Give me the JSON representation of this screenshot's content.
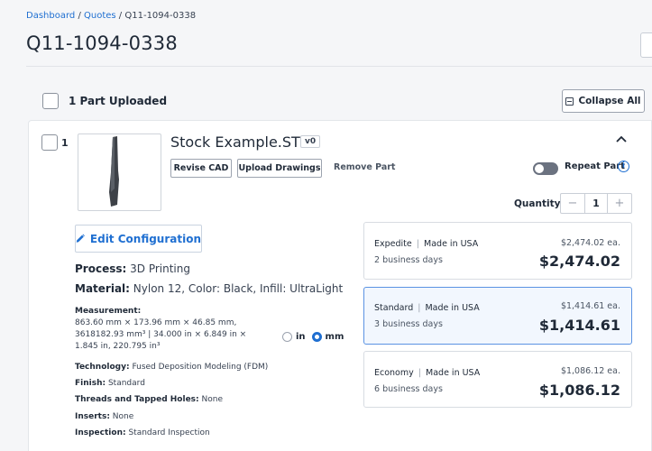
{
  "breadcrumb": {
    "dashboard": "Dashboard",
    "quotes": "Quotes",
    "current": "Q11-1094-0338",
    "sep": " / "
  },
  "page": {
    "title": "Q11-1094-0338"
  },
  "header": {
    "uploaded_label": "1 Part Uploaded",
    "collapse_label": "Collapse All"
  },
  "part": {
    "number": "1",
    "name": "Stock Example.STL",
    "version": "v0",
    "revise_cad": "Revise CAD",
    "upload_drawings": "Upload Drawings",
    "remove": "Remove Part",
    "repeat_label": "Repeat Part",
    "repeat_on": false,
    "quantity_label": "Quantity",
    "quantity": "1",
    "edit_config": "Edit Configuration",
    "process_label": "Process:",
    "process": "3D Printing",
    "material_label": "Material:",
    "material": "Nylon 12, Color: Black, Infill: UltraLight",
    "measurement_label": "Measurement:",
    "measurement_lines": [
      "863.60 mm × 173.96 mm × 46.85 mm,",
      "3618182.93 mm³  |  34.000 in × 6.849 in ×",
      "1.845 in, 220.795 in³"
    ],
    "unit_in": "in",
    "unit_mm": "mm",
    "unit_selected": "mm",
    "technology_label": "Technology:",
    "technology": "Fused Deposition Modeling (FDM)",
    "finish_label": "Finish:",
    "finish": "Standard",
    "threads_label": "Threads and Tapped Holes:",
    "threads": "None",
    "inserts_label": "Inserts:",
    "inserts": "None",
    "inspection_label": "Inspection:",
    "inspection": "Standard Inspection"
  },
  "pricing": [
    {
      "tier": "Expedite",
      "origin": "Made in USA",
      "sep": "|",
      "days": "2 business days",
      "each": "$2,474.02 ea.",
      "total": "$2,474.02",
      "selected": false
    },
    {
      "tier": "Standard",
      "origin": "Made in USA",
      "sep": "|",
      "days": "3 business days",
      "each": "$1,414.61 ea.",
      "total": "$1,414.61",
      "selected": true
    },
    {
      "tier": "Economy",
      "origin": "Made in USA",
      "sep": "|",
      "days": "6 business days",
      "each": "$1,086.12 ea.",
      "total": "$1,086.12",
      "selected": false
    }
  ],
  "colors": {
    "accent": "#1f6fd1",
    "selected_bg": "#f2f7fe",
    "toggle_off": "#6b7280"
  }
}
